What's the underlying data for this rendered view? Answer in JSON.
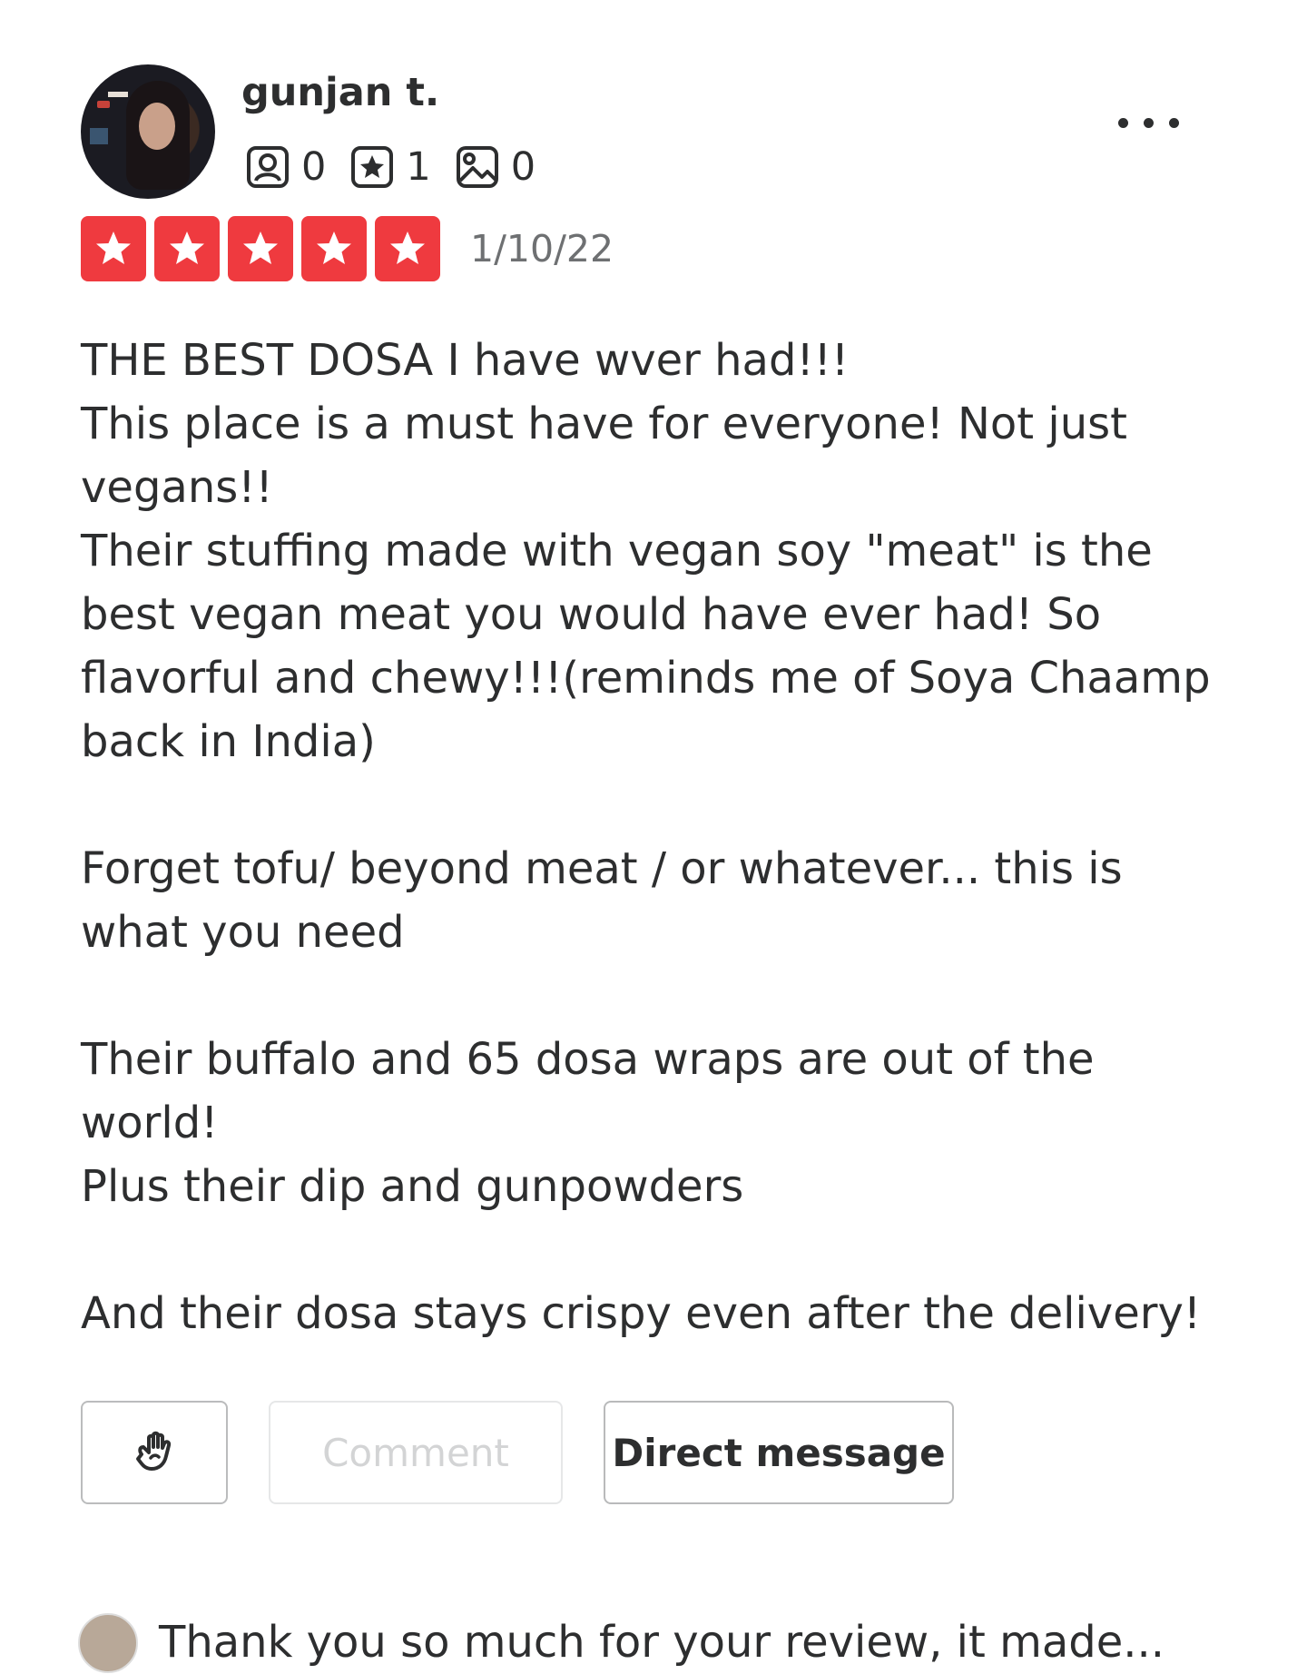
{
  "reviewer": {
    "name": "gunjan t.",
    "stats": [
      {
        "icon": "friends-icon",
        "value": "0"
      },
      {
        "icon": "reviews-star-icon",
        "value": "1"
      },
      {
        "icon": "photos-icon",
        "value": "0"
      }
    ]
  },
  "rating": {
    "stars": 5,
    "max": 5,
    "color": "#ef3a3f"
  },
  "date": "1/10/22",
  "review_text": [
    "THE BEST DOSA I have wver had!!!",
    "This place is a must have for everyone! Not just vegans!!",
    "Their stuffing made with vegan soy \"meat\" is the best vegan meat you would have ever had! So flavorful and chewy!!!(reminds me of Soya Chaamp back in India)",
    "",
    "Forget tofu/ beyond meat / or whatever... this is what you need",
    "",
    "Their buffalo and 65 dosa wraps are out of the world!",
    "Plus their dip and gunpowders",
    "",
    "And their dosa stays crispy even after the delivery!"
  ],
  "actions": {
    "react_icon": "react-hand-icon",
    "comment_label": "Comment",
    "dm_label": "Direct message"
  },
  "next_item_text": "Thank you so much for your review, it made..."
}
